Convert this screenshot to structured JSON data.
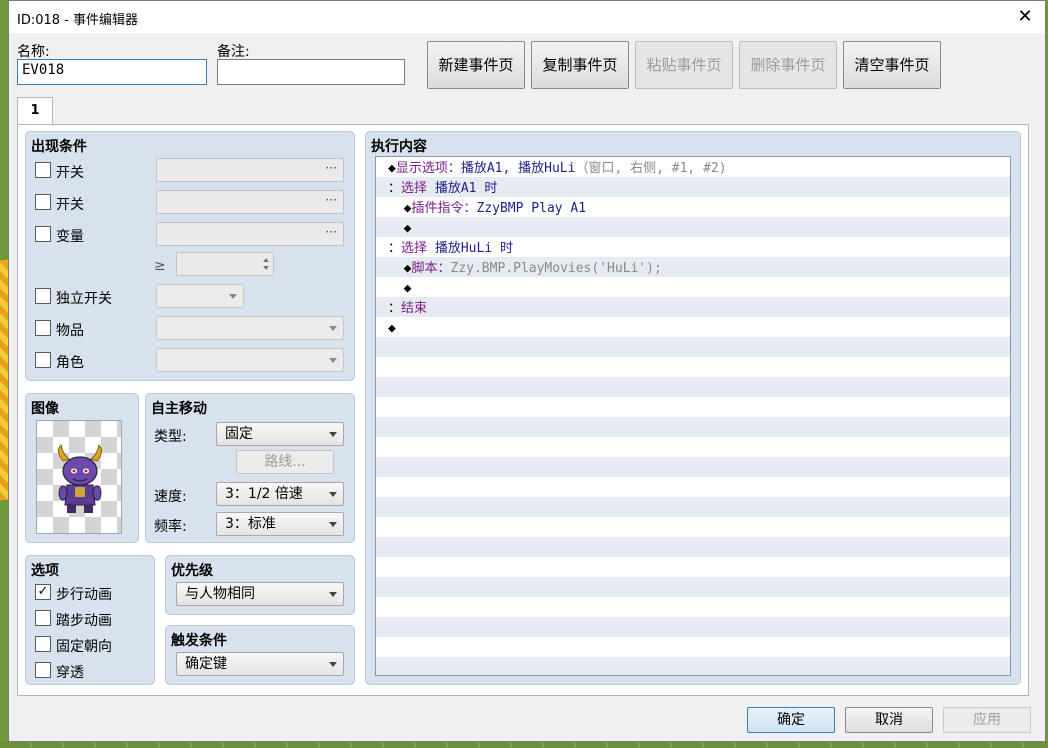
{
  "window": {
    "title": "ID:018 - 事件编辑器",
    "close": "✕"
  },
  "name_label": "名称:",
  "name_value": "EV018",
  "note_label": "备注:",
  "note_value": "",
  "toolbar": {
    "new_page": "新建事件页",
    "copy_page": "复制事件页",
    "paste_page": "粘贴事件页",
    "delete_page": "删除事件页",
    "clear_page": "清空事件页"
  },
  "tab_label": "1",
  "conditions": {
    "title": "出现条件",
    "switch1": "开关",
    "switch2": "开关",
    "variable": "变量",
    "ge": "≥",
    "self_switch": "独立开关",
    "item": "物品",
    "actor": "角色",
    "dots": "···"
  },
  "image": {
    "title": "图像"
  },
  "movement": {
    "title": "自主移动",
    "type_label": "类型:",
    "type_value": "固定",
    "route_button": "路线...",
    "speed_label": "速度:",
    "speed_value": "3：1/2 倍速",
    "freq_label": "频率:",
    "freq_value": "3：标准"
  },
  "options": {
    "title": "选项",
    "walking": "步行动画",
    "stepping": "踏步动画",
    "direction_fix": "固定朝向",
    "through": "穿透",
    "check": "✓"
  },
  "priority": {
    "title": "优先级",
    "value": "与人物相同"
  },
  "trigger": {
    "title": "触发条件",
    "value": "确定键"
  },
  "contents": {
    "title": "执行内容",
    "lines": [
      {
        "prefix": "◆",
        "cmd": "显示选项：",
        "arg": "播放A1, 播放HuLi",
        "extra": "（窗口, 右侧, #1, #2)"
      },
      {
        "prefix": "：",
        "cmd": "选择 ",
        "arg": "播放A1 时",
        "extra": ""
      },
      {
        "prefix": "  ◆",
        "cmd": "插件指令：",
        "arg": "ZzyBMP Play A1",
        "extra": ""
      },
      {
        "prefix": "  ◆",
        "cmd": "",
        "arg": "",
        "extra": ""
      },
      {
        "prefix": "：",
        "cmd": "选择 ",
        "arg": "播放HuLi 时",
        "extra": ""
      },
      {
        "prefix": "  ◆",
        "cmd": "脚本：",
        "arg": "",
        "extra": "Zzy.BMP.PlayMovies('HuLi');"
      },
      {
        "prefix": "  ◆",
        "cmd": "",
        "arg": "",
        "extra": ""
      },
      {
        "prefix": "：",
        "cmd": "结束",
        "arg": "",
        "extra": ""
      },
      {
        "prefix": "◆",
        "cmd": "",
        "arg": "",
        "extra": ""
      }
    ]
  },
  "footer": {
    "ok": "确定",
    "cancel": "取消",
    "apply": "应用"
  }
}
